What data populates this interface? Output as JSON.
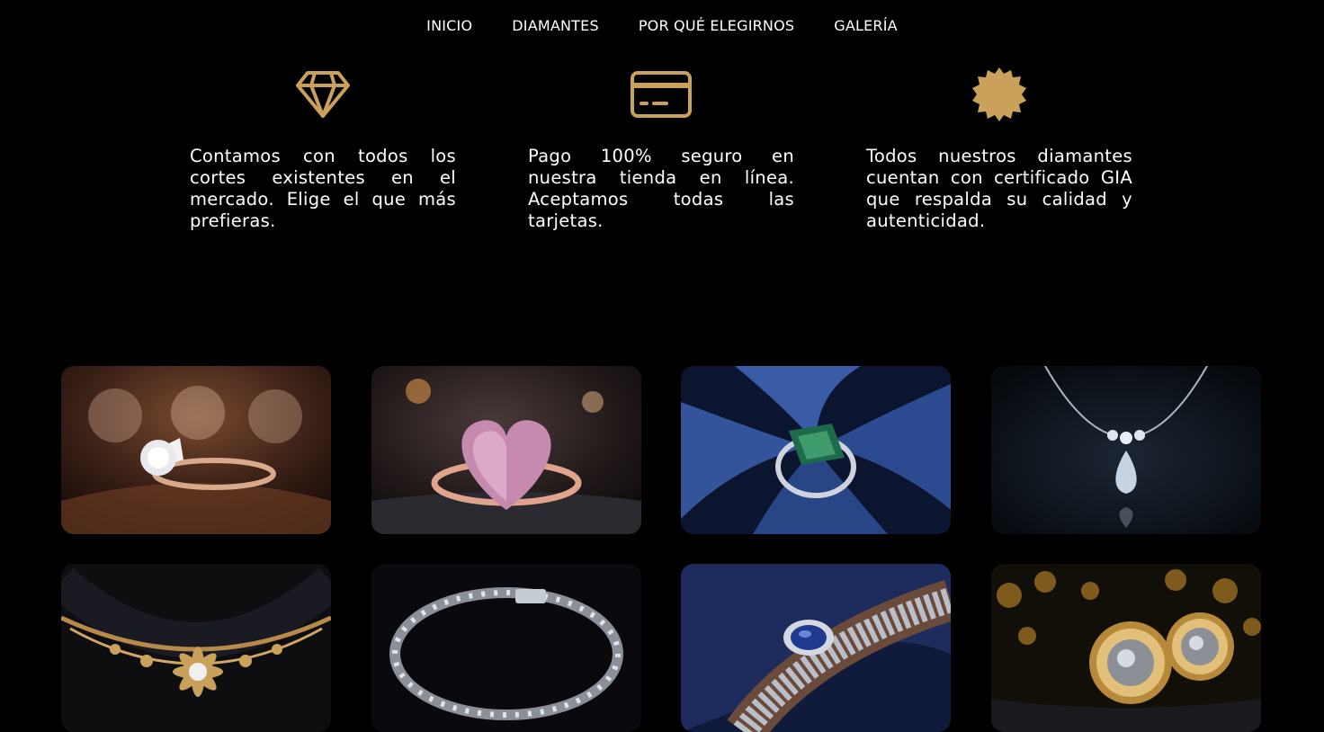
{
  "nav": {
    "items": [
      {
        "label": "INICIO"
      },
      {
        "label": "DIAMANTES"
      },
      {
        "label": "POR QUÉ ELEGIRNOS"
      },
      {
        "label": "GALERÍA"
      }
    ]
  },
  "colors": {
    "accent_gold": "#c9a15a",
    "background": "#000000",
    "text": "#ffffff"
  },
  "features": [
    {
      "icon": "diamond-icon",
      "text": "Contamos con todos los cortes existentes en el mercado. Elige el que más prefieras."
    },
    {
      "icon": "credit-card-icon",
      "text": "Pago 100% seguro en nuestra tienda en línea. Aceptamos todas las tarjetas."
    },
    {
      "icon": "certificate-badge-icon",
      "text": "Todos nuestros diamantes cuentan con certificado GIA que respalda su calidad y autenticidad."
    }
  ],
  "gallery": [
    {
      "name": "diamond-solitaire-ring-image"
    },
    {
      "name": "pink-heart-diamond-ring-image"
    },
    {
      "name": "emerald-ring-on-velvet-image"
    },
    {
      "name": "pear-diamond-pendant-necklace-image"
    },
    {
      "name": "gold-floral-diamond-necklace-image"
    },
    {
      "name": "diamond-tennis-bracelet-image"
    },
    {
      "name": "sapphire-diamond-bracelet-image"
    },
    {
      "name": "gold-halo-diamond-earrings-image"
    }
  ]
}
